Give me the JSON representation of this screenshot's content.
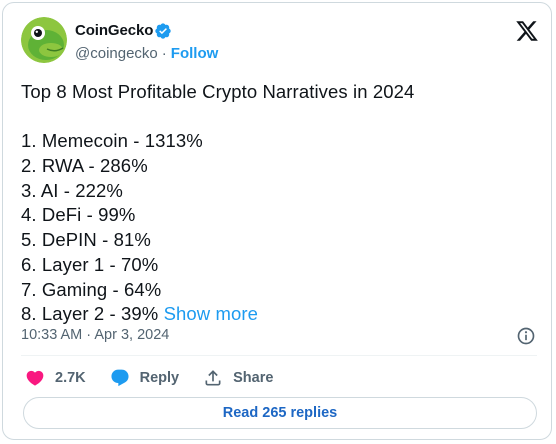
{
  "author": {
    "name": "CoinGecko",
    "handle": "@coingecko",
    "separator": "·",
    "follow_label": "Follow"
  },
  "tweet": {
    "title": "Top 8 Most Profitable Crypto Narratives in 2024",
    "items": [
      "1. Memecoin - 1313%",
      "2. RWA - 286%",
      "3. AI - 222%",
      "4. DeFi - 99%",
      "5. DePIN - 81%",
      "6. Layer 1 - 70%",
      "7. Gaming - 64%",
      "8. Layer 2 - 39%"
    ],
    "show_more": "Show more"
  },
  "timestamp": "10:33 AM · Apr 3, 2024",
  "actions": {
    "like_count": "2.7K",
    "reply_label": "Reply",
    "share_label": "Share"
  },
  "read_replies_label": "Read 265 replies",
  "colors": {
    "accent": "#1d9bf0",
    "like": "#f91880",
    "verified": "#1d9bf0",
    "avatar_bg": "#8dc63f"
  },
  "icons": [
    "verified-icon",
    "x-logo-icon",
    "info-icon",
    "heart-icon",
    "reply-bubble-icon",
    "share-icon"
  ]
}
